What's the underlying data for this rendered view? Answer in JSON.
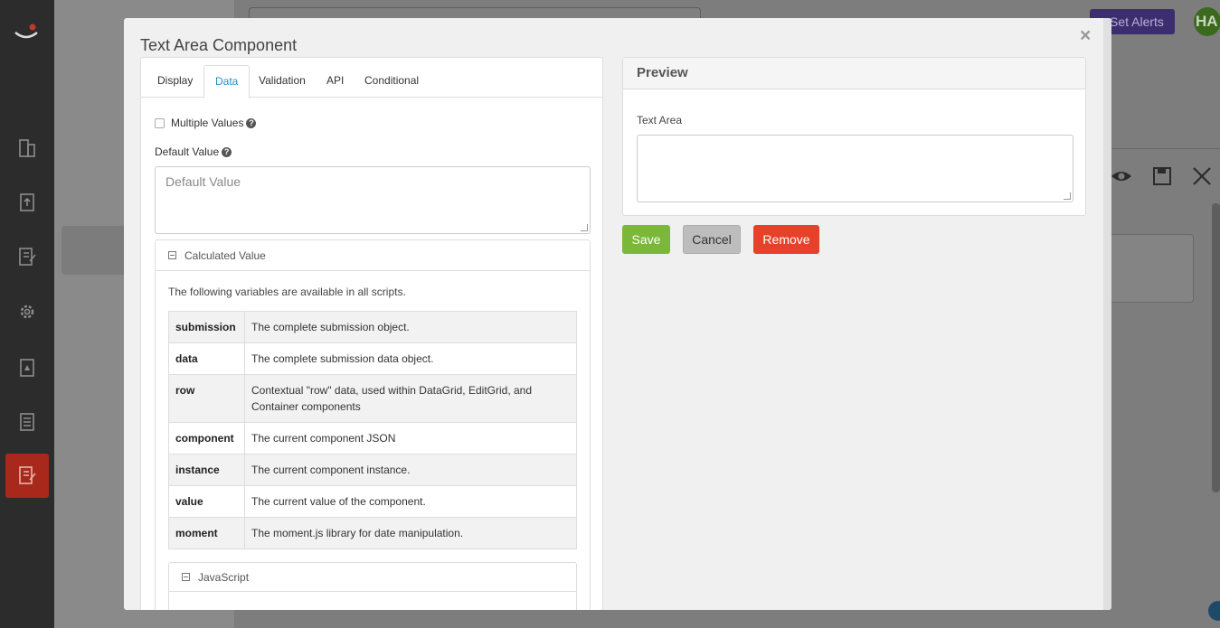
{
  "background": {
    "alert_button_label": "Set Alerts",
    "avatar_initials": "HA",
    "rail_icons": [
      "building-icon",
      "upload-icon",
      "form-edit-icon",
      "gear-icon",
      "warning-document-icon",
      "document-list-icon",
      "form-edit-icon"
    ],
    "toolbar_icons": [
      "eye-icon",
      "save-icon",
      "close-icon"
    ]
  },
  "modal": {
    "title": "Text Area Component",
    "close_glyph": "×",
    "tabs": [
      {
        "label": "Display",
        "active": false
      },
      {
        "label": "Data",
        "active": true
      },
      {
        "label": "Validation",
        "active": false
      },
      {
        "label": "API",
        "active": false
      },
      {
        "label": "Conditional",
        "active": false
      }
    ],
    "multiple_values_label": "Multiple Values",
    "help_glyph": "?",
    "default_value_label": "Default Value",
    "default_value_placeholder": "Default Value",
    "calculated_value": {
      "title": "Calculated Value",
      "intro": "The following variables are available in all scripts.",
      "variables": [
        {
          "name": "submission",
          "description": "The complete submission object."
        },
        {
          "name": "data",
          "description": "The complete submission data object."
        },
        {
          "name": "row",
          "description": "Contextual \"row\" data, used within DataGrid, EditGrid, and Container components"
        },
        {
          "name": "component",
          "description": "The current component JSON"
        },
        {
          "name": "instance",
          "description": "The current component instance."
        },
        {
          "name": "value",
          "description": "The current value of the component."
        },
        {
          "name": "moment",
          "description": "The moment.js library for date manipulation."
        }
      ],
      "javascript_title": "JavaScript"
    },
    "preview": {
      "title": "Preview",
      "field_label": "Text Area"
    },
    "buttons": {
      "save": "Save",
      "cancel": "Cancel",
      "remove": "Remove"
    }
  },
  "colors": {
    "accent": "#2a8fbd",
    "save": "#7bb83a",
    "remove": "#e7412a",
    "rail_active": "#a8281c"
  }
}
